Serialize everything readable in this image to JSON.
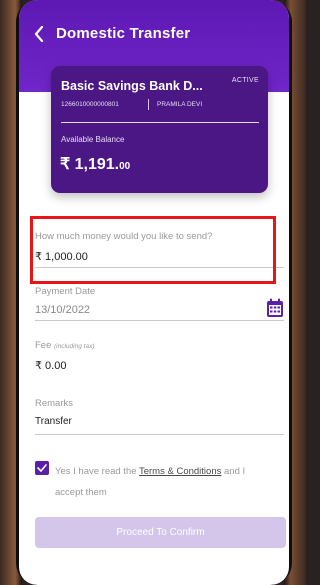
{
  "header": {
    "title": "Domestic Transfer"
  },
  "card": {
    "name": "Basic Savings Bank D...",
    "status": "ACTIVE",
    "account_number": "1266010000000801",
    "holder": "PRAMILA DEVI",
    "balance_label": "Available Balance",
    "balance_main": "₹ 1,191.",
    "balance_cents": "00"
  },
  "form": {
    "amount_label": "How much money would you like to send?",
    "amount_value": "₹ 1,000.00",
    "date_label": "Payment Date",
    "date_value": "13/10/2022",
    "fee_label": "Fee",
    "fee_hint": "(including tax)",
    "fee_value": "₹ 0.00",
    "remarks_label": "Remarks",
    "remarks_value": "Transfer"
  },
  "consent": {
    "prefix": "Yes I have read the ",
    "link": "Terms & Conditions",
    "suffix": " and I accept them",
    "checked": true
  },
  "actions": {
    "proceed_label": "Proceed To Confirm"
  },
  "icons": {
    "back": "chevron-left-icon",
    "calendar": "calendar-icon",
    "check": "checkmark-icon"
  },
  "colors": {
    "header": "#6a1fbf",
    "card": "#4a1785",
    "highlight": "#e8141c",
    "button_disabled": "#d4c6ea"
  }
}
